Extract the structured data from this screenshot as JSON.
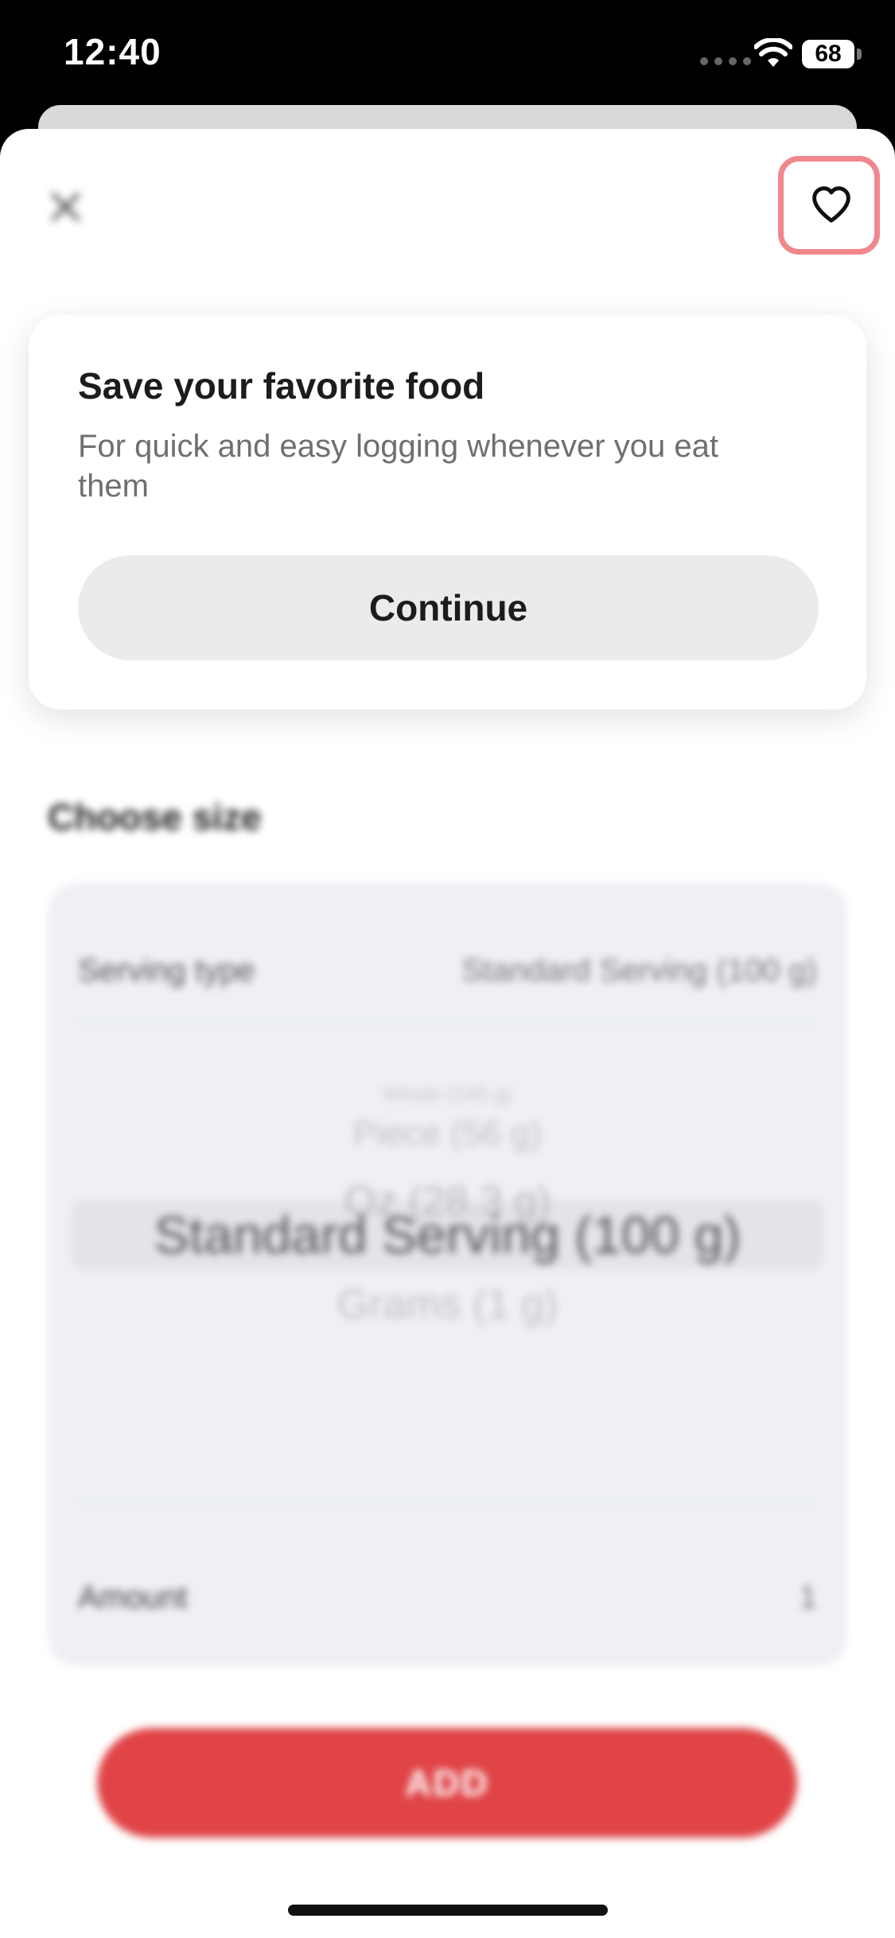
{
  "status_bar": {
    "time": "12:40",
    "battery": "68"
  },
  "tooltip": {
    "title": "Save your favorite food",
    "body": "For quick and easy logging whenever you eat them",
    "button_label": "Continue"
  },
  "background": {
    "section_title": "Choose size",
    "serving_type_label": "Serving type",
    "serving_type_value": "Standard Serving (100 g)",
    "picker_options": [
      "Whole (245 g)",
      "Piece (56 g)",
      "Oz (28.3 g)",
      "Standard Serving (100 g)",
      "Grams (1 g)"
    ],
    "amount_label": "Amount",
    "amount_value": "1",
    "add_label": "ADD"
  },
  "colors": {
    "accent": "#e04447",
    "highlight_ring": "#f0878c"
  },
  "icons": {
    "close": "close-icon",
    "favorite": "heart-icon"
  }
}
